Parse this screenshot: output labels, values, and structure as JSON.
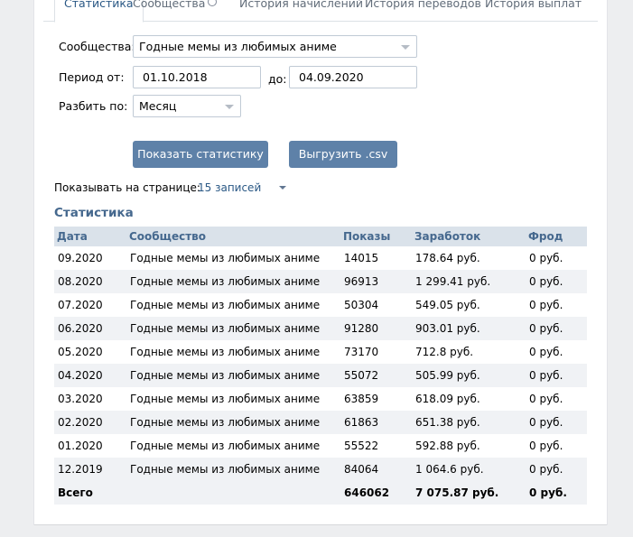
{
  "tabs": [
    {
      "label": "Статистика",
      "active": true
    },
    {
      "label": "Сообщества",
      "loading": true
    },
    {
      "label": "История начислений"
    },
    {
      "label": "История переводов"
    },
    {
      "label": "История выплат"
    }
  ],
  "form": {
    "community_label": "Сообщества:",
    "community_value": "Годные мемы из любимых аниме",
    "period_from_label": "Период от:",
    "period_from_value": "01.10.2018",
    "period_to_label": "до:",
    "period_to_value": "04.09.2020",
    "split_label": "Разбить по:",
    "split_value": "Месяц",
    "show_button": "Показать статистику",
    "export_button": "Выгрузить .csv"
  },
  "per_page": {
    "label": "Показывать на странице:",
    "value": "15 записей"
  },
  "stats": {
    "title": "Статистика",
    "columns": [
      "Дата",
      "Сообщество",
      "Показы",
      "Заработок",
      "Фрод"
    ],
    "rows": [
      [
        "09.2020",
        "Годные мемы из любимых аниме",
        "14015",
        "178.64 руб.",
        "0 руб."
      ],
      [
        "08.2020",
        "Годные мемы из любимых аниме",
        "96913",
        "1 299.41 руб.",
        "0 руб."
      ],
      [
        "07.2020",
        "Годные мемы из любимых аниме",
        "50304",
        "549.05 руб.",
        "0 руб."
      ],
      [
        "06.2020",
        "Годные мемы из любимых аниме",
        "91280",
        "903.01 руб.",
        "0 руб."
      ],
      [
        "05.2020",
        "Годные мемы из любимых аниме",
        "73170",
        "712.8 руб.",
        "0 руб."
      ],
      [
        "04.2020",
        "Годные мемы из любимых аниме",
        "55072",
        "505.99 руб.",
        "0 руб."
      ],
      [
        "03.2020",
        "Годные мемы из любимых аниме",
        "63859",
        "618.09 руб.",
        "0 руб."
      ],
      [
        "02.2020",
        "Годные мемы из любимых аниме",
        "61863",
        "651.38 руб.",
        "0 руб."
      ],
      [
        "01.2020",
        "Годные мемы из любимых аниме",
        "55522",
        "592.88 руб.",
        "0 руб."
      ],
      [
        "12.2019",
        "Годные мемы из любимых аниме",
        "84064",
        "1 064.6 руб.",
        "0 руб."
      ]
    ],
    "total": [
      "Всего",
      "",
      "646062",
      "7 075.87 руб.",
      "0 руб."
    ]
  }
}
